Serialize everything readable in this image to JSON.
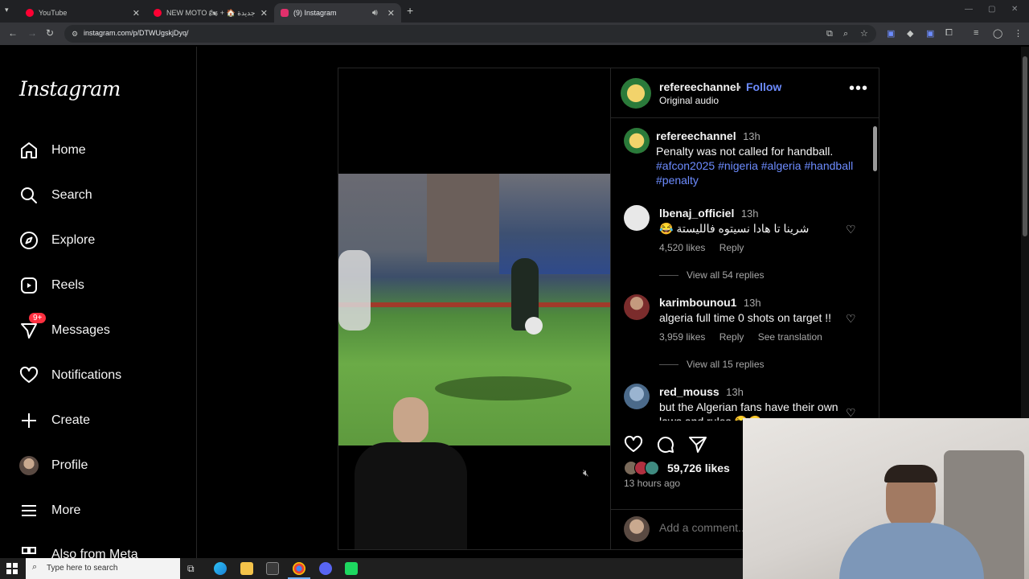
{
  "browser": {
    "tabs": [
      {
        "title": "YouTube",
        "favicon_color": "#ff0033",
        "active": false
      },
      {
        "title": "NEW MOTO 🏍 + 🏠 دار جديدة",
        "favicon_color": "#ff0033",
        "active": false
      },
      {
        "title": "(9) Instagram",
        "favicon_color": "#e1306c",
        "active": true
      }
    ],
    "url": "instagram.com/p/DTWUgskjDyq/"
  },
  "nav": {
    "logo": "Instagram",
    "items": [
      {
        "label": "Home",
        "icon": "home-icon"
      },
      {
        "label": "Search",
        "icon": "search-icon"
      },
      {
        "label": "Explore",
        "icon": "compass-icon"
      },
      {
        "label": "Reels",
        "icon": "reels-icon"
      },
      {
        "label": "Messages",
        "icon": "messenger-icon",
        "badge": "9+"
      },
      {
        "label": "Notifications",
        "icon": "heart-icon"
      },
      {
        "label": "Create",
        "icon": "plus-icon"
      },
      {
        "label": "Profile",
        "icon": "profile-avatar"
      },
      {
        "label": "More",
        "icon": "menu-icon"
      },
      {
        "label": "Also from Meta",
        "icon": "meta-icon"
      }
    ]
  },
  "post": {
    "author": "refereechannel",
    "follow_label": "Follow",
    "audio": "Original audio",
    "caption": {
      "username": "refereechannel",
      "time": "13h",
      "text": "Penalty was not called for handball.",
      "hashtags": "#afcon2025 #nigeria #algeria #handball #penalty"
    },
    "comments": [
      {
        "username": "lbenaj_officiel",
        "time": "13h",
        "text": "😂 شرينا تا هادا نسيتوه فالليستة",
        "likes": "4,520 likes",
        "reply": "Reply",
        "view_replies": "View all 54 replies"
      },
      {
        "username": "karimbounou1",
        "time": "13h",
        "text": "algeria full time 0 shots on target !!",
        "likes": "3,959 likes",
        "reply": "Reply",
        "translate": "See translation",
        "view_replies": "View all 15 replies"
      },
      {
        "username": "red_mouss",
        "time": "13h",
        "text": "but the Algerian fans have their own laws and rules 😂😂"
      }
    ],
    "likes": "59,726 likes",
    "time_ago": "13 hours ago",
    "add_comment_placeholder": "Add a comment..."
  },
  "taskbar": {
    "search_placeholder": "Type here to search"
  }
}
